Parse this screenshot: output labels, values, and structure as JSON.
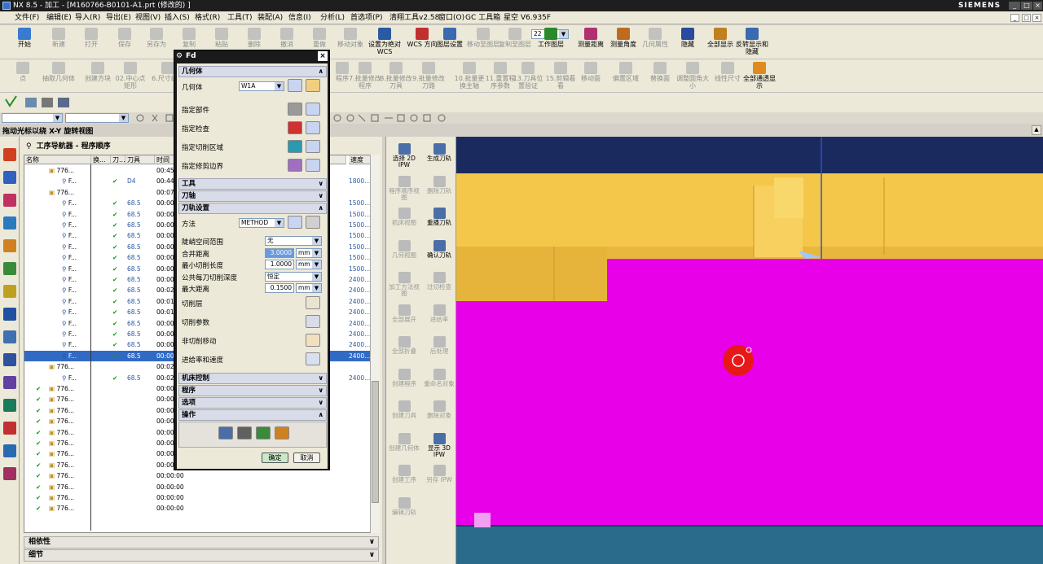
{
  "window": {
    "title": "NX 8.5 - 加工 - [M160766-B0101-A1.prt (修改的) ]",
    "brand": "SIEMENS"
  },
  "menu": [
    "文件(F)",
    "编辑(E)",
    "导入(R)",
    "导出(E)",
    "视图(V)",
    "插入(S)",
    "格式(R)",
    "工具(T)",
    "装配(A)",
    "信息(I)",
    "分析(L)",
    "首选项(P)",
    "清翔工具v2.58",
    "窗口(O)",
    "GC 工具箱",
    "星空 V6.935F"
  ],
  "toolbar1": [
    {
      "label": "开始",
      "icon": "start-icon",
      "enabled": true
    },
    {
      "label": "新建",
      "icon": "new-icon",
      "enabled": false
    },
    {
      "label": "打开",
      "icon": "open-icon",
      "enabled": false
    },
    {
      "label": "保存",
      "icon": "save-icon",
      "enabled": false
    },
    {
      "label": "另存为",
      "icon": "save-as-icon",
      "enabled": false
    },
    {
      "label": "复制",
      "icon": "copy-icon",
      "enabled": false
    },
    {
      "label": "粘贴",
      "icon": "paste-icon",
      "enabled": false
    },
    {
      "label": "删除",
      "icon": "delete-icon",
      "enabled": false
    },
    {
      "label": "撤消",
      "icon": "undo-icon",
      "enabled": false
    },
    {
      "label": "重做",
      "icon": "redo-icon",
      "enabled": false
    },
    {
      "label": "移动对象",
      "icon": "move-object-icon",
      "enabled": false
    },
    {
      "label": "设置为绝对 WCS",
      "icon": "set-abs-wcs-icon",
      "enabled": true
    },
    {
      "label": "WCS 方向",
      "icon": "wcs-orient-icon",
      "enabled": true
    },
    {
      "label": "图层设置",
      "icon": "layer-settings-icon",
      "enabled": true
    },
    {
      "label": "移动至图层",
      "icon": "move-to-layer-icon",
      "enabled": false
    },
    {
      "label": "复制至图层",
      "icon": "copy-to-layer-icon",
      "enabled": false
    },
    {
      "label": "工作图层",
      "icon": "work-layer-icon",
      "enabled": true
    },
    {
      "label": "测量距离",
      "icon": "measure-distance-icon",
      "enabled": true
    },
    {
      "label": "测量角度",
      "icon": "measure-angle-icon",
      "enabled": true
    },
    {
      "label": "几何属性",
      "icon": "geometry-props-icon",
      "enabled": false
    },
    {
      "label": "隐藏",
      "icon": "hide-icon",
      "enabled": true
    },
    {
      "label": "全部显示",
      "icon": "show-all-icon",
      "enabled": true
    },
    {
      "label": "反转显示和隐藏",
      "icon": "invert-show-icon",
      "enabled": true
    }
  ],
  "work_layer_value": "22",
  "toolbar2": [
    {
      "label": "点",
      "icon": "point-icon"
    },
    {
      "label": "抽取几何体",
      "icon": "extract-geometry-icon"
    },
    {
      "label": "创建方块",
      "icon": "create-block-icon"
    },
    {
      "label": "02.中心点矩形",
      "icon": "center-rect-icon"
    },
    {
      "label": "6.尺寸编子",
      "icon": "size-icon"
    },
    {
      "label": "程序",
      "icon": "program-icon"
    },
    {
      "label": "7.批量修改程序",
      "icon": "batch-program-icon"
    },
    {
      "label": "8.批量修改刀具",
      "icon": "batch-tool-icon"
    },
    {
      "label": "9.批量修改刀路",
      "icon": "batch-path-icon"
    },
    {
      "label": "10.批量更换主轴",
      "icon": "batch-spindle-icon"
    },
    {
      "label": "11.重置程序参数",
      "icon": "reset-params-icon"
    },
    {
      "label": "13.刀具位置验证",
      "icon": "tool-pos-icon"
    },
    {
      "label": "15.剪辑看看",
      "icon": "clip-icon"
    },
    {
      "label": "移动面",
      "icon": "move-face-icon"
    },
    {
      "label": "偏置区域",
      "icon": "offset-region-icon"
    },
    {
      "label": "替换面",
      "icon": "replace-face-icon"
    },
    {
      "label": "调整圆角大小",
      "icon": "resize-fillet-icon"
    },
    {
      "label": "线性尺寸",
      "icon": "linear-dim-icon"
    },
    {
      "label": "全部通透显示",
      "icon": "transparent-icon"
    }
  ],
  "status_text": "拖动光标以绕 X-Y 旋转视图",
  "navigator": {
    "title": "工序导航器 - 程序顺序",
    "columns": [
      "名称",
      "换...",
      "刀...",
      "刀具",
      "时间",
      "...",
      "速度"
    ],
    "rows": [
      {
        "name": "776...",
        "tool": "",
        "time": "00:45:",
        "speed": "",
        "check": false,
        "level": 1
      },
      {
        "name": "F...",
        "tool": "D4",
        "time": "00:44:",
        "speed": "1800...",
        "check": true,
        "level": 2
      },
      {
        "name": "776...",
        "tool": "",
        "time": "00:07:",
        "speed": "",
        "check": false,
        "level": 1
      },
      {
        "name": "F...",
        "tool": "68.5",
        "time": "00:00:",
        "speed": "1500...",
        "check": true,
        "level": 2
      },
      {
        "name": "F...",
        "tool": "68.5",
        "time": "00:00:",
        "speed": "1500...",
        "check": true,
        "level": 2
      },
      {
        "name": "F...",
        "tool": "68.5",
        "time": "00:00:",
        "speed": "1500...",
        "check": true,
        "level": 2
      },
      {
        "name": "F...",
        "tool": "68.5",
        "time": "00:00:",
        "speed": "1500...",
        "check": true,
        "level": 2
      },
      {
        "name": "F...",
        "tool": "68.5",
        "time": "00:00:",
        "speed": "1500...",
        "check": true,
        "level": 2
      },
      {
        "name": "F...",
        "tool": "68.5",
        "time": "00:00:",
        "speed": "1500...",
        "check": true,
        "level": 2
      },
      {
        "name": "F...",
        "tool": "68.5",
        "time": "00:00:",
        "speed": "1500...",
        "check": true,
        "level": 2
      },
      {
        "name": "F...",
        "tool": "68.5",
        "time": "00:00:",
        "speed": "2400...",
        "check": true,
        "level": 2
      },
      {
        "name": "F...",
        "tool": "68.5",
        "time": "00:02:",
        "speed": "2400...",
        "check": true,
        "level": 2
      },
      {
        "name": "F...",
        "tool": "68.5",
        "time": "00:01:",
        "speed": "2400...",
        "check": true,
        "level": 2
      },
      {
        "name": "F...",
        "tool": "68.5",
        "time": "00:01:",
        "speed": "2400...",
        "check": true,
        "level": 2
      },
      {
        "name": "F...",
        "tool": "68.5",
        "time": "00:00:",
        "speed": "2400...",
        "check": true,
        "level": 2
      },
      {
        "name": "F...",
        "tool": "68.5",
        "time": "00:00:",
        "speed": "2400...",
        "check": true,
        "level": 2
      },
      {
        "name": "F...",
        "tool": "68.5",
        "time": "00:00:",
        "speed": "2400...",
        "check": true,
        "level": 2
      },
      {
        "name": "F...",
        "tool": "68.5",
        "time": "00:00:",
        "speed": "2400...",
        "check": true,
        "level": 2,
        "selected": true
      },
      {
        "name": "776...",
        "tool": "",
        "time": "00:02:",
        "speed": "",
        "check": false,
        "level": 1
      },
      {
        "name": "F...",
        "tool": "68.5",
        "time": "00:02:",
        "speed": "2400...",
        "check": true,
        "level": 2
      },
      {
        "name": "776...",
        "tool": "",
        "time": "00:00:",
        "speed": "",
        "check": true,
        "level": 1
      },
      {
        "name": "776...",
        "tool": "",
        "time": "00:00:",
        "speed": "",
        "check": true,
        "level": 1
      },
      {
        "name": "776...",
        "tool": "",
        "time": "00:00:",
        "speed": "",
        "check": true,
        "level": 1
      },
      {
        "name": "776...",
        "tool": "",
        "time": "00:00:",
        "speed": "",
        "check": true,
        "level": 1
      },
      {
        "name": "776...",
        "tool": "",
        "time": "00:00:",
        "speed": "",
        "check": true,
        "level": 1
      },
      {
        "name": "776...",
        "tool": "",
        "time": "00:00:00",
        "speed": "",
        "check": true,
        "level": 1
      },
      {
        "name": "776...",
        "tool": "",
        "time": "00:00:00",
        "speed": "",
        "check": true,
        "level": 1
      },
      {
        "name": "776...",
        "tool": "",
        "time": "00:00:00",
        "speed": "",
        "check": true,
        "level": 1
      },
      {
        "name": "776...",
        "tool": "",
        "time": "00:00:00",
        "speed": "",
        "check": true,
        "level": 1
      },
      {
        "name": "776...",
        "tool": "",
        "time": "00:00:00",
        "speed": "",
        "check": true,
        "level": 1
      },
      {
        "name": "776...",
        "tool": "",
        "time": "00:00:00",
        "speed": "",
        "check": true,
        "level": 1
      },
      {
        "name": "776...",
        "tool": "",
        "time": "00:00:00",
        "speed": "",
        "check": true,
        "level": 1
      }
    ],
    "sections": [
      "相依性",
      "细节"
    ]
  },
  "dialog": {
    "title": "Fd",
    "geometry_header": "几何体",
    "geometry_label": "几何体",
    "geometry_value": "W1A",
    "geometry_rows": [
      "指定部件",
      "指定检查",
      "指定切削区域",
      "指定修剪边界"
    ],
    "collapsed1": [
      "工具",
      "刀轴"
    ],
    "path_header": "刀轨设置",
    "method_label": "方法",
    "method_value": "METHOD",
    "fields": [
      {
        "label": "陡峭空间范围",
        "value": "无",
        "type": "select"
      },
      {
        "label": "合并距离",
        "value": "3.0000",
        "unit": "mm",
        "type": "number",
        "highlight": true
      },
      {
        "label": "最小切削长度",
        "value": "1.0000",
        "unit": "mm",
        "type": "number"
      },
      {
        "label": "公共每刀切削深度",
        "value": "恒定",
        "type": "select"
      },
      {
        "label": "最大距离",
        "value": "0.1500",
        "unit": "mm",
        "type": "number"
      }
    ],
    "actions": [
      "切削层",
      "切削参数",
      "非切削移动",
      "进给率和速度"
    ],
    "collapsed2": [
      "机床控制",
      "程序",
      "选项"
    ],
    "ops_header": "操作",
    "ok": "确定",
    "cancel": "取消"
  },
  "op_buttons": [
    {
      "label": "选择 2D IPW",
      "enabled": true
    },
    {
      "label": "生成刀轨",
      "enabled": true
    },
    {
      "label": "程序顺序视图",
      "enabled": false
    },
    {
      "label": "删除刀轨",
      "enabled": false
    },
    {
      "label": "机床视图",
      "enabled": false
    },
    {
      "label": "重播刀轨",
      "enabled": true
    },
    {
      "label": "几何视图",
      "enabled": false
    },
    {
      "label": "确认刀轨",
      "enabled": true
    },
    {
      "label": "加工方法视图",
      "enabled": false
    },
    {
      "label": "过切检查",
      "enabled": false
    },
    {
      "label": "全部展开",
      "enabled": false
    },
    {
      "label": "进给率",
      "enabled": false
    },
    {
      "label": "全部折叠",
      "enabled": false
    },
    {
      "label": "后处理",
      "enabled": false
    },
    {
      "label": "创建程序",
      "enabled": false
    },
    {
      "label": "重命名对象",
      "enabled": false
    },
    {
      "label": "创建刀具",
      "enabled": false
    },
    {
      "label": "删除对象",
      "enabled": false
    },
    {
      "label": "创建几何体",
      "enabled": false
    },
    {
      "label": "显示 3D IPW",
      "enabled": true
    },
    {
      "label": "创建工序",
      "enabled": false
    },
    {
      "label": "另存 IPW",
      "enabled": false
    },
    {
      "label": "编辑刀轨",
      "enabled": false
    }
  ],
  "colors": {
    "magenta": "#e800e8",
    "yellow": "#f4c64a",
    "navy": "#1a2a5e",
    "teal": "#2a6a8a",
    "selection": "#316ac5"
  }
}
